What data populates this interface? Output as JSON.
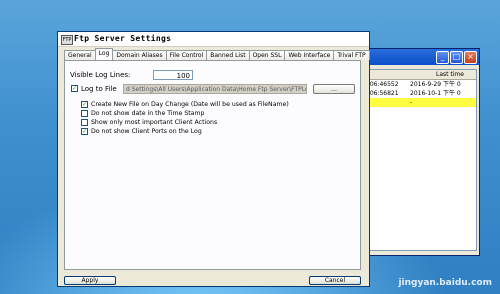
{
  "background_window": {
    "header_last_time": "Last time",
    "rows": [
      {
        "col1": "106:46552",
        "col2": "2016-9-29 下午 0"
      },
      {
        "col1": "106:56821",
        "col2": "2016-10-1 下午 0"
      },
      {
        "col1": "",
        "col2": "-"
      }
    ]
  },
  "dialog": {
    "title": "Ftp Server Settings",
    "tabs": [
      "General",
      "Log",
      "Domain Aliases",
      "File Control",
      "Banned List",
      "Open SSL",
      "Web Interface",
      "Trival FTP"
    ],
    "active_tab": "Log",
    "log": {
      "visible_lines_label": "Visible Log Lines:",
      "visible_lines_value": "100",
      "log_to_file_label": "Log to File",
      "log_to_file_checked": true,
      "log_path": "d Settings\\All Users\\Application Data\\Home Ftp Server\\FTPLog.txt",
      "browse_label": "...",
      "options": [
        {
          "label": "Create New File on Day Change (Date will be used as FileName)",
          "checked": true
        },
        {
          "label": "Do not show date in the Time Stamp",
          "checked": false
        },
        {
          "label": "Show only most important Client Actions",
          "checked": false
        },
        {
          "label": "Do not show Client Ports on the Log",
          "checked": true
        }
      ]
    },
    "apply_label": "Apply",
    "cancel_label": "Cancel"
  },
  "watermark": "jingyan.baidu.com"
}
